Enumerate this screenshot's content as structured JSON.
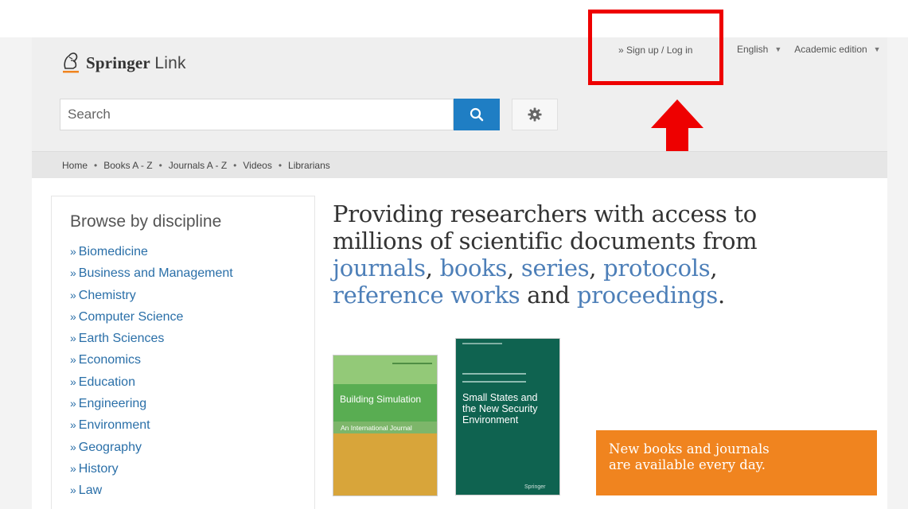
{
  "brand": {
    "name_bold": "Springer",
    "name_light": "Link"
  },
  "header": {
    "signup_label": "» Sign up / Log in",
    "language_label": "English",
    "edition_label": "Academic edition"
  },
  "search": {
    "placeholder": "Search"
  },
  "icons": {
    "search": "search-icon",
    "settings": "gear-icon",
    "dropdown": "caret-down-icon",
    "annotation_arrow": "arrow-up-icon"
  },
  "nav": {
    "items": [
      "Home",
      "Books A - Z",
      "Journals A - Z",
      "Videos",
      "Librarians"
    ]
  },
  "browse": {
    "title": "Browse by discipline",
    "items": [
      "Biomedicine",
      "Business and Management",
      "Chemistry",
      "Computer Science",
      "Earth Sciences",
      "Economics",
      "Education",
      "Engineering",
      "Environment",
      "Geography",
      "History",
      "Law"
    ]
  },
  "tagline": {
    "line1": "Providing researchers with access to",
    "line2": "millions of scientific documents from",
    "journals": "journals",
    "books": "books",
    "series": "series",
    "protocols": "protocols",
    "reference_works": "reference works",
    "and": "and",
    "proceedings": "proceedings"
  },
  "covers": {
    "cover1_title": "Building Simulation",
    "cover1_subtitle": "An International Journal",
    "cover2_title_l1": "Small States and",
    "cover2_title_l2": "the New Security",
    "cover2_title_l3": "Environment",
    "cover2_publisher": "Springer"
  },
  "promo": {
    "line1": "New books and journals",
    "line2": "are available every day."
  },
  "colors": {
    "accent_blue": "#1f7ec4",
    "link_blue": "#2a6fa8",
    "promo_orange": "#f0841f",
    "annotation_red": "#ee0000"
  }
}
